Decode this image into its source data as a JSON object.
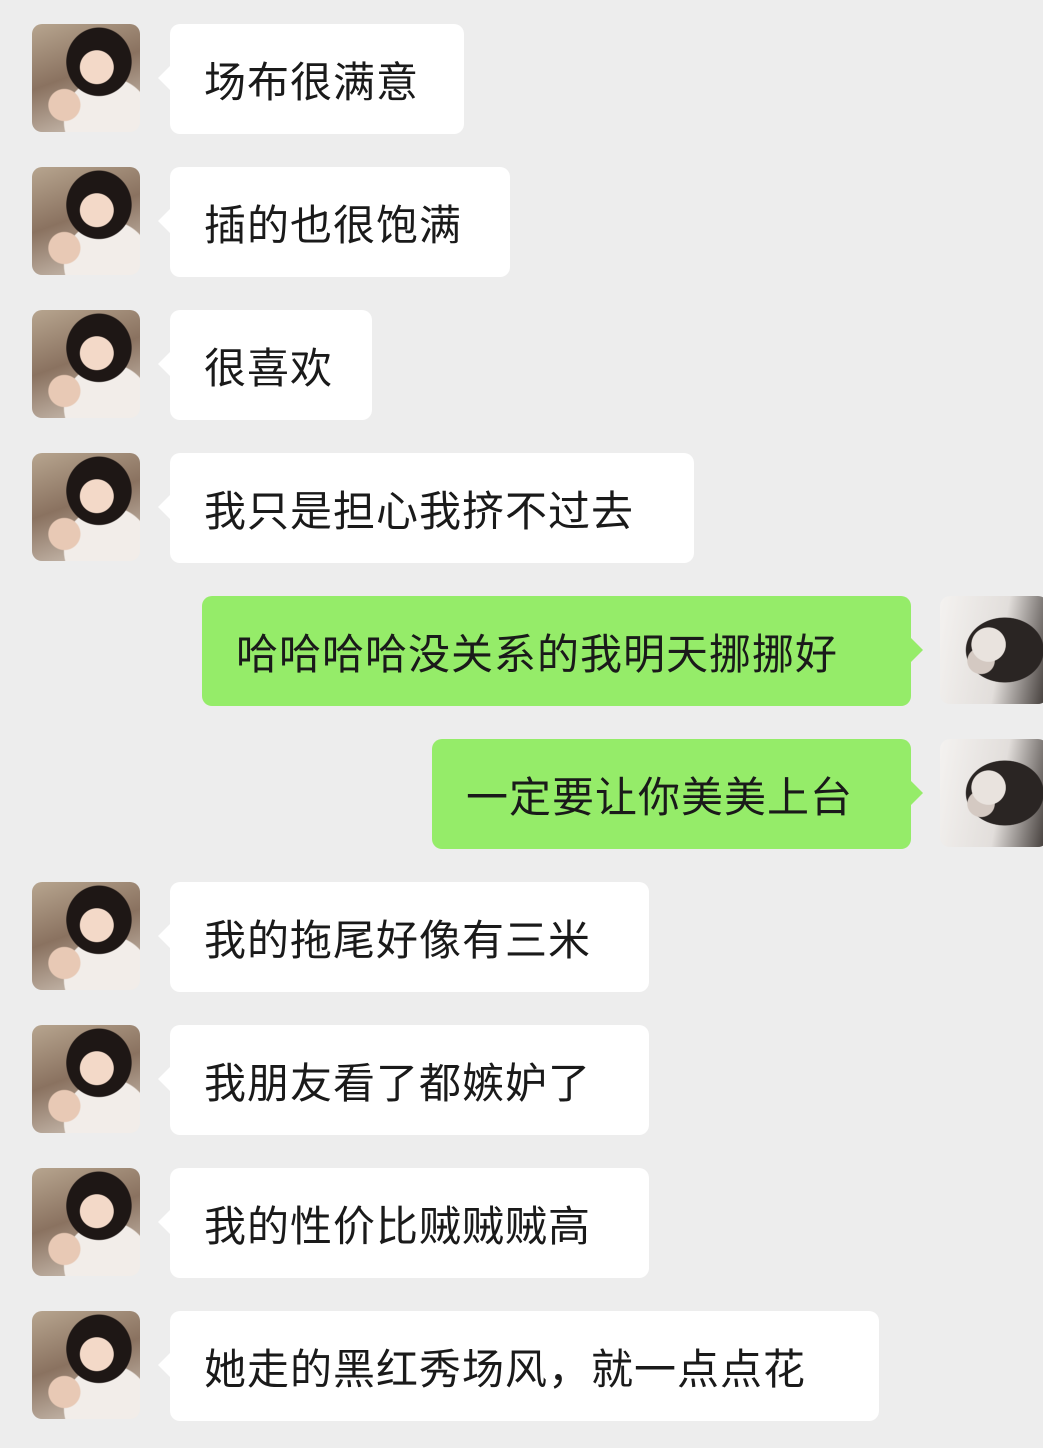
{
  "colors": {
    "background": "#ededed",
    "incoming_bubble": "#ffffff",
    "outgoing_bubble": "#95ec69",
    "text": "#1a1a1a"
  },
  "messages": [
    {
      "sender": "other",
      "text": "场布很满意"
    },
    {
      "sender": "other",
      "text": "插的也很饱满"
    },
    {
      "sender": "other",
      "text": "很喜欢"
    },
    {
      "sender": "other",
      "text": "我只是担心我挤不过去"
    },
    {
      "sender": "me",
      "text": "哈哈哈哈没关系的我明天挪挪好"
    },
    {
      "sender": "me",
      "text": "一定要让你美美上台"
    },
    {
      "sender": "other",
      "text": "我的拖尾好像有三米"
    },
    {
      "sender": "other",
      "text": "我朋友看了都嫉妒了"
    },
    {
      "sender": "other",
      "text": "我的性价比贼贼贼高"
    },
    {
      "sender": "other",
      "text": "她走的黑红秀场风，就一点点花"
    }
  ]
}
